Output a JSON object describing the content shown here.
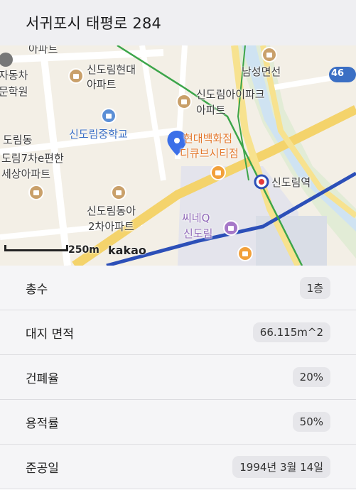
{
  "header": {
    "address": "서귀포시 태평로 284"
  },
  "map": {
    "labels": {
      "apt_top": "아파트",
      "jacha": "자동차",
      "hakwon": "문학원",
      "hyundai_1": "신도림현대",
      "hyundai_2": "아파트",
      "namsung": "남성면선",
      "ipark_1": "신도림아이파크",
      "ipark_2": "아파트",
      "middle_school": "신도림중학교",
      "dong": "도림동",
      "e_1": "도림7차e편한",
      "e_2": "세상아파트",
      "dept_1": "현대백화점",
      "dept_2": "디큐브시티점",
      "station": "신도림역",
      "dong2_1": "신도림동아",
      "dong2_2": "2차아파트",
      "cinema_1": "씨네Q",
      "cinema_2": "신도림"
    },
    "road_number": "46",
    "scale": "250m",
    "attribution": "kakao",
    "colors": {
      "road": "#f4d36b",
      "subway_blue": "#2c4fb8",
      "subway_green": "#3ca54a",
      "pin": "#3b6fe8"
    }
  },
  "details": [
    {
      "key": "총수",
      "value": "1층"
    },
    {
      "key": "대지 면적",
      "value": "66.115m^2"
    },
    {
      "key": "건폐율",
      "value": "20%"
    },
    {
      "key": "용적률",
      "value": "50%"
    },
    {
      "key": "준공일",
      "value": "1994년 3월 14일"
    }
  ]
}
